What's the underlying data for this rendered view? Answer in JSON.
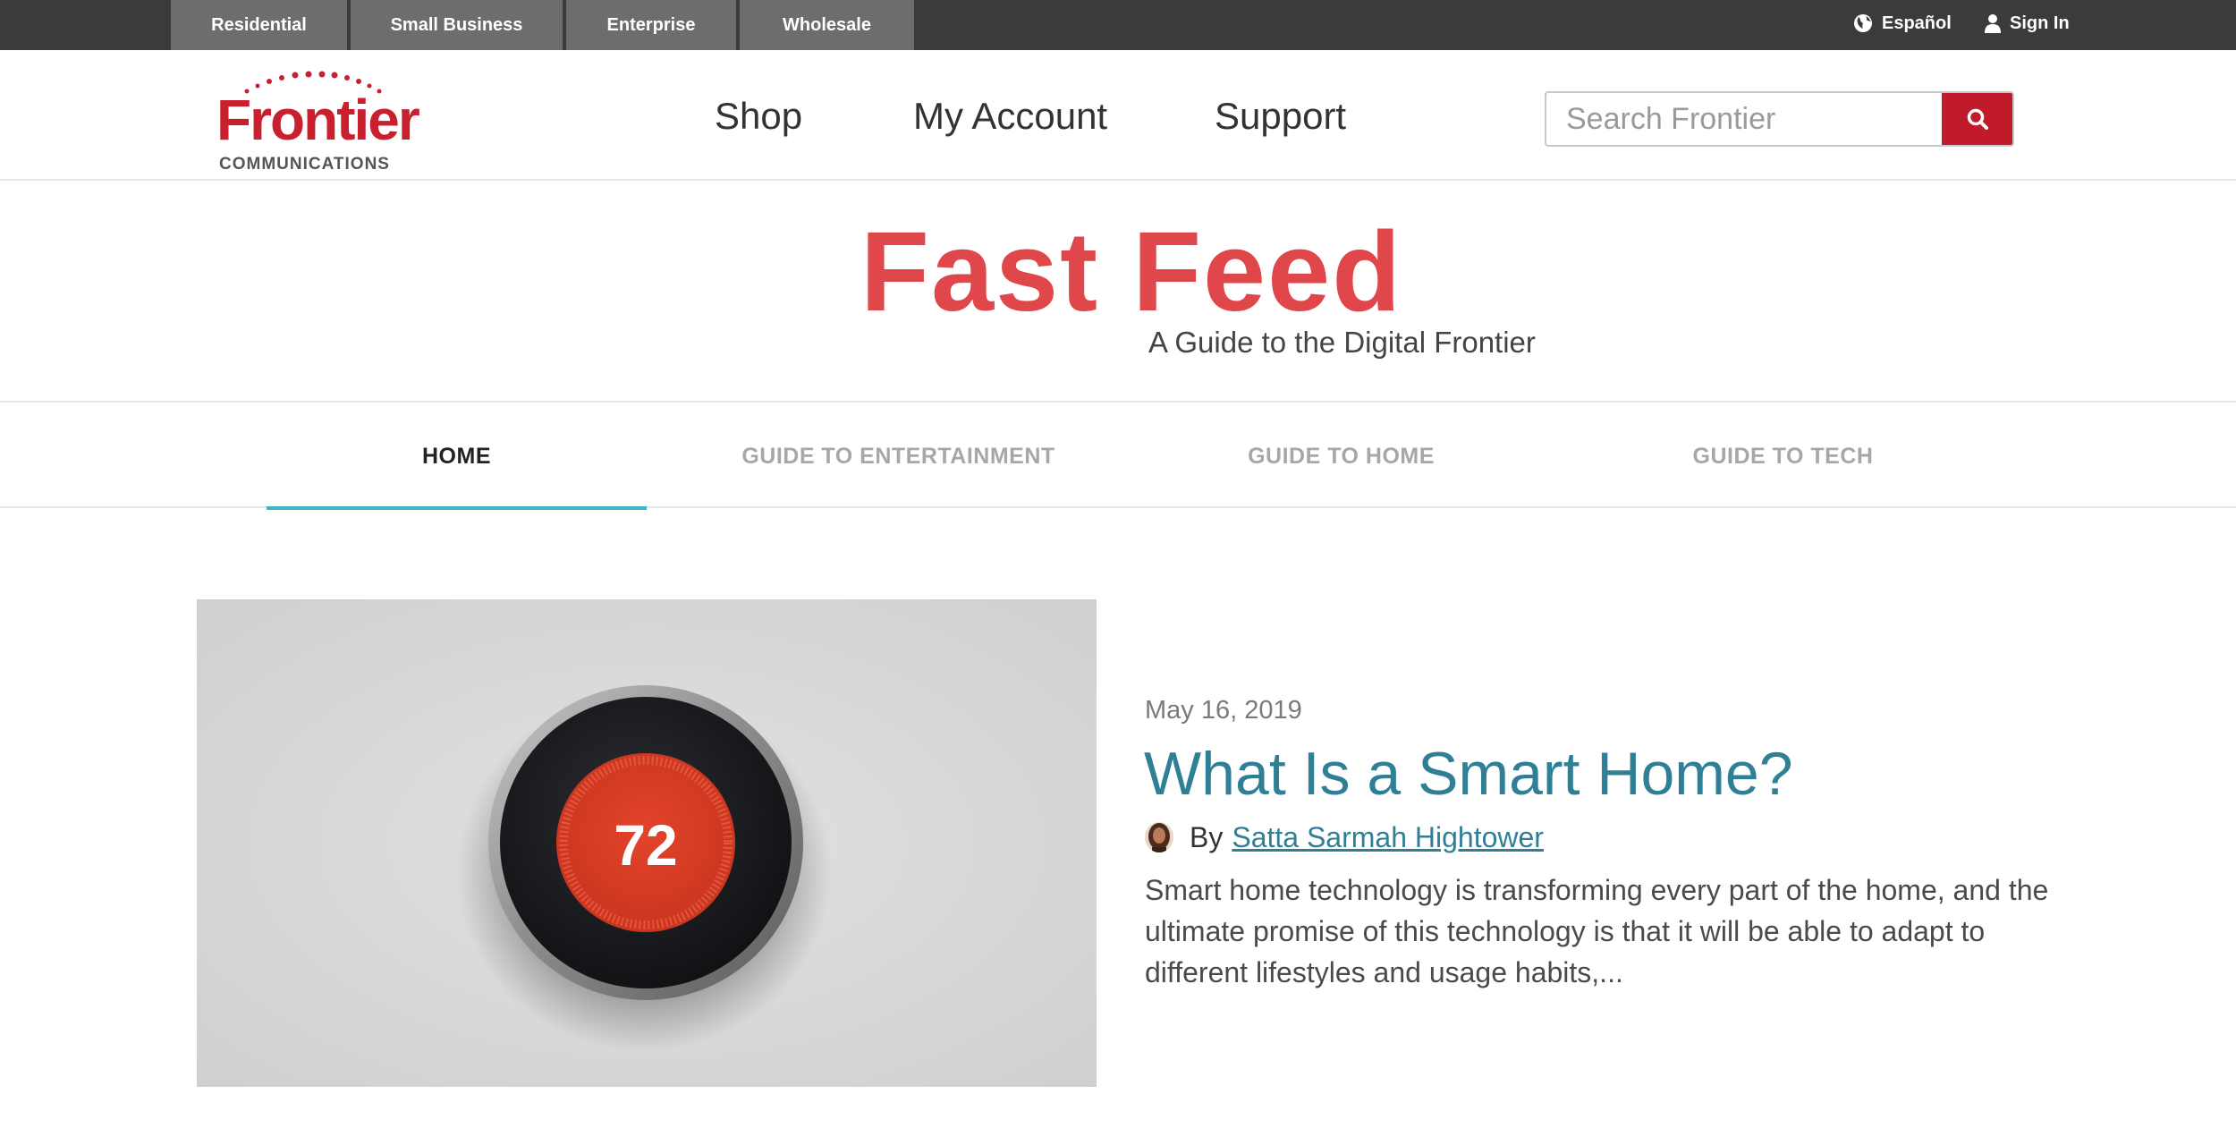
{
  "topbar": {
    "segments": [
      "Residential",
      "Small Business",
      "Enterprise",
      "Wholesale"
    ],
    "language_label": "Español",
    "signin_label": "Sign In"
  },
  "header": {
    "logo_text": "Frontier",
    "logo_sub": "COMMUNICATIONS",
    "nav": [
      "Shop",
      "My Account",
      "Support"
    ],
    "search_placeholder": "Search Frontier"
  },
  "blog": {
    "title": "Fast Feed",
    "tagline": "A Guide to the Digital Frontier",
    "tabs": [
      "HOME",
      "GUIDE TO ENTERTAINMENT",
      "GUIDE TO HOME",
      "GUIDE TO TECH"
    ],
    "active_tab": "HOME"
  },
  "article": {
    "image_text": "72",
    "date": "May 16, 2019",
    "title": "What Is a Smart Home?",
    "by": "By",
    "author": "Satta Sarmah Hightower",
    "excerpt": "Smart home technology is transforming every part of the home, and the ultimate promise of this technology is that it will be able to adapt to different lifestyles and usage habits,..."
  },
  "colors": {
    "brand_red": "#c8202f",
    "title_red": "#e0474a",
    "link_teal": "#2f7f96",
    "tab_underline": "#3bb3c8",
    "topbar": "#3b3b3d"
  },
  "icons": {
    "language": "globe-icon",
    "signin": "user-icon",
    "search": "search-icon"
  }
}
